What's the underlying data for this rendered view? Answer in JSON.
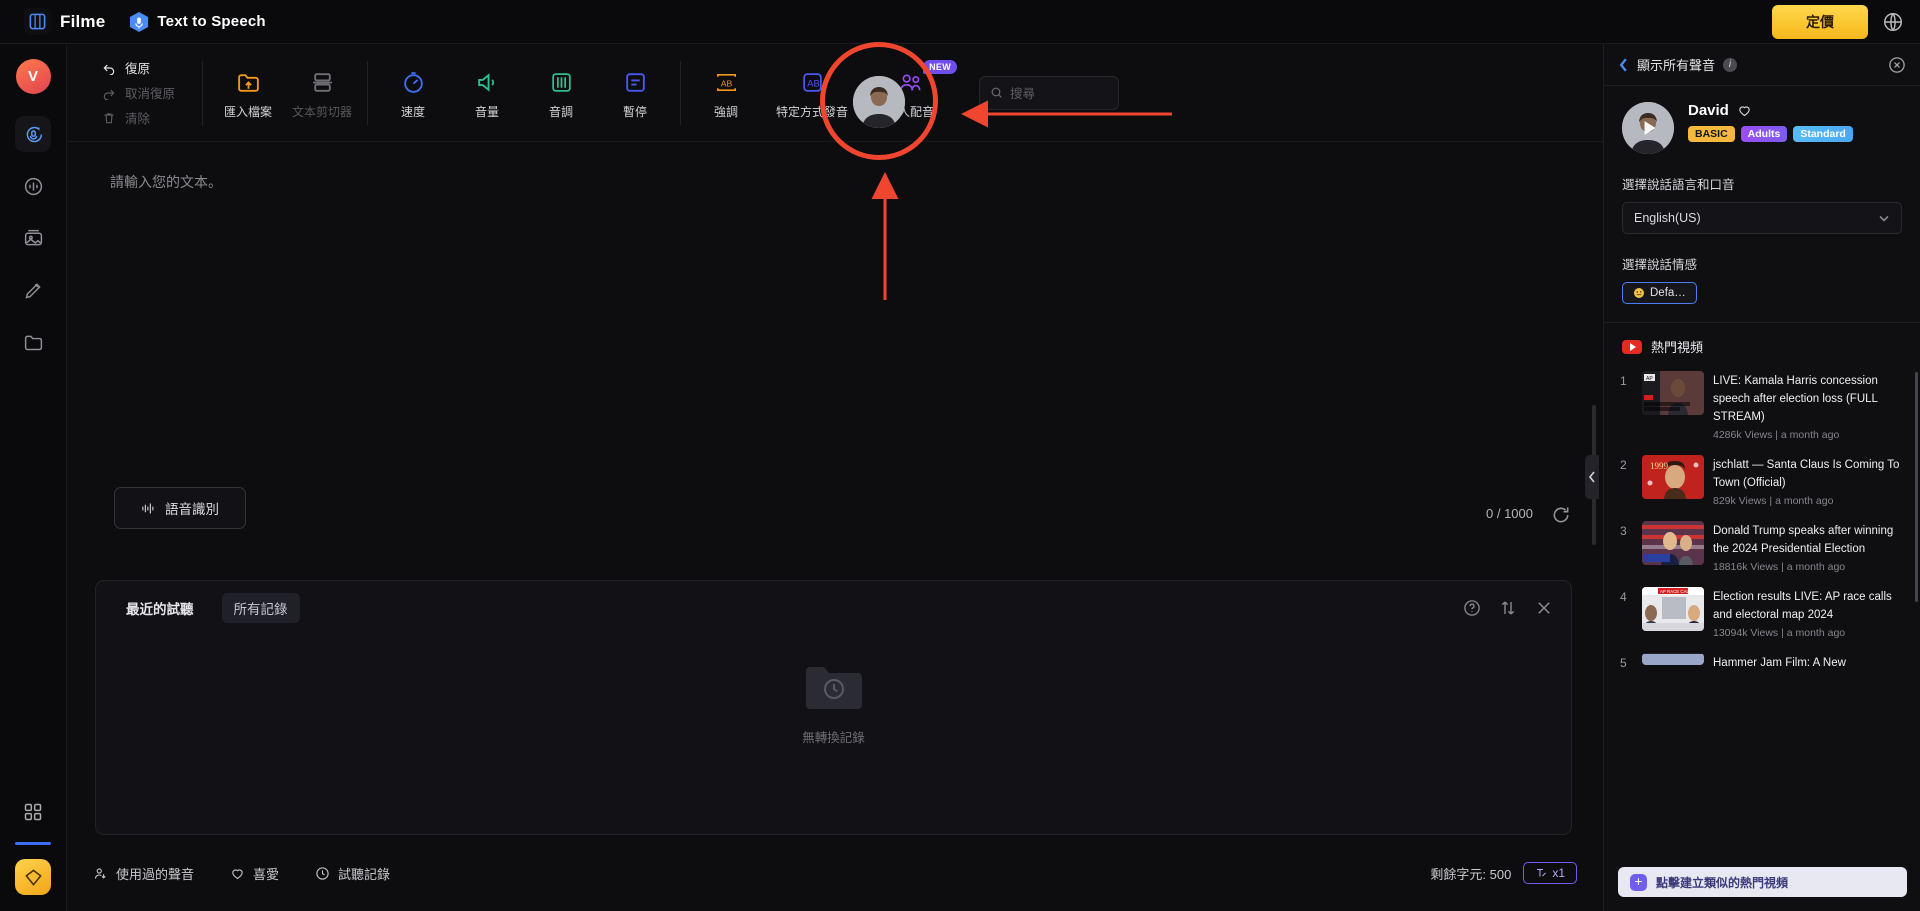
{
  "topbar": {
    "brand": "Filme",
    "module": "Text to Speech",
    "pricing_button": "定價",
    "icons": {
      "logo": "filme-logo-icon",
      "tts": "microphone-hex-icon",
      "globe": "globe-icon"
    }
  },
  "rail": {
    "avatar_initial": "V",
    "items": [
      {
        "name": "sidebar-item-tts",
        "icon": "speech-bubble-mic-icon"
      },
      {
        "name": "sidebar-item-voice-clone",
        "icon": "voice-wave-icon"
      },
      {
        "name": "sidebar-item-media",
        "icon": "image-stack-icon"
      },
      {
        "name": "sidebar-item-edit",
        "icon": "pen-icon"
      },
      {
        "name": "sidebar-item-projects",
        "icon": "folder-icon"
      }
    ],
    "bottom": {
      "grid": "grid-apps-icon",
      "gem": "diamond-upgrade-icon"
    }
  },
  "toolbar": {
    "undo": "復原",
    "redo": "取消復原",
    "clear": "清除",
    "tools": [
      {
        "label": "匯入檔案",
        "icon": "import-file-icon",
        "disabled": false
      },
      {
        "label": "文本剪切器",
        "icon": "text-splitter-icon",
        "disabled": true
      },
      {
        "label": "速度",
        "icon": "speed-icon",
        "disabled": false
      },
      {
        "label": "音量",
        "icon": "volume-icon",
        "disabled": false
      },
      {
        "label": "音調",
        "icon": "pitch-sliders-icon",
        "disabled": false
      },
      {
        "label": "暫停",
        "icon": "pause-insert-icon",
        "disabled": false
      },
      {
        "label": "強調",
        "icon": "emphasis-ab-icon",
        "disabled": false
      },
      {
        "label": "特定方式發音",
        "icon": "pronunciation-icon",
        "disabled": false
      },
      {
        "label": "多人配音",
        "icon": "multi-voice-icon",
        "disabled": false,
        "badge": "NEW"
      }
    ],
    "search_placeholder": "搜尋"
  },
  "editor": {
    "placeholder": "請輸入您的文本。",
    "recognize_button": "語音識別",
    "counter": "0 / 1000",
    "refresh_icon": "refresh-icon"
  },
  "recent": {
    "tab_recent": "最近的試聽",
    "tab_all": "所有記錄",
    "empty_text": "無轉換記錄",
    "actions": [
      {
        "name": "help-icon",
        "glyph": "?"
      },
      {
        "name": "sort-icon",
        "glyph": "⇅"
      },
      {
        "name": "close-icon",
        "glyph": "✕"
      }
    ]
  },
  "footer": {
    "used_voices": "使用過的聲音",
    "favorites": "喜愛",
    "history": "試聽記錄",
    "chars_remaining": "剩餘字元: 500",
    "multiplier": "x1"
  },
  "right_panel": {
    "back_title": "顯示所有聲音",
    "close_icon": "close-circle-icon",
    "voice": {
      "name": "David",
      "favorite_icon": "heart-outline-icon",
      "tags": [
        "BASIC",
        "Adults",
        "Standard"
      ]
    },
    "language_label": "選擇說話語言和口音",
    "language_value": "English(US)",
    "emotion_label": "選擇說話情感",
    "emotion_value": "Defa…",
    "trending_title": "熱門視頻",
    "videos": [
      {
        "rank": "1",
        "title": "LIVE: Kamala Harris concession speech after election loss (FULL STREAM)",
        "stats": "4286k Views | a month ago"
      },
      {
        "rank": "2",
        "title": "jschlatt — Santa Claus Is Coming To Town (Official)",
        "stats": "829k Views | a month ago"
      },
      {
        "rank": "3",
        "title": "Donald Trump speaks after winning the 2024 Presidential Election",
        "stats": "18816k Views | a month ago"
      },
      {
        "rank": "4",
        "title": "Election results LIVE: AP race calls and electoral map 2024",
        "stats": "13094k Views | a month ago"
      },
      {
        "rank": "5",
        "title": "Hammer Jam Film: A New",
        "stats": ""
      }
    ],
    "cta": "點擊建立類似的熱門視頻"
  },
  "colors": {
    "accent_red": "#f0452e",
    "brand_yellow": "#f5b71a",
    "purple": "#6f5df0",
    "blue": "#3b6ef5"
  }
}
